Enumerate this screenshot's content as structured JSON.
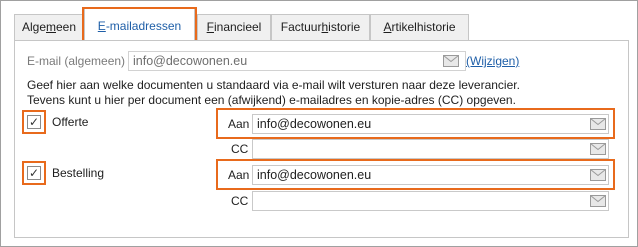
{
  "tabs": [
    {
      "label_pre": "Alge",
      "label_ul": "m",
      "label_post": "een",
      "active": false
    },
    {
      "label_pre": "",
      "label_ul": "E",
      "label_post": "-mailadressen",
      "active": true
    },
    {
      "label_pre": "",
      "label_ul": "F",
      "label_post": "inancieel",
      "active": false
    },
    {
      "label_pre": "Factuur",
      "label_ul": "h",
      "label_post": "istorie",
      "active": false
    },
    {
      "label_pre": "",
      "label_ul": "A",
      "label_post": "rtikelhistorie",
      "active": false
    }
  ],
  "general": {
    "label": "E-mail (algemeen)",
    "value": "info@decowonen.eu",
    "change_link": "(Wijzigen)"
  },
  "description": {
    "line1": "Geef hier aan welke documenten u standaard via e-mail wilt versturen naar deze leverancier.",
    "line2": "Tevens kunt u hier per document een (afwijkend) e-mailadres en kopie-adres (CC) opgeven."
  },
  "documents": [
    {
      "label": "Offerte",
      "checked": true,
      "to_label": "Aan",
      "to_value": "info@decowonen.eu",
      "cc_label": "CC",
      "cc_value": "",
      "check_glyph": "✓"
    },
    {
      "label": "Bestelling",
      "checked": true,
      "to_label": "Aan",
      "to_value": "info@decowonen.eu",
      "cc_label": "CC",
      "cc_value": "",
      "check_glyph": "✓"
    }
  ],
  "colors": {
    "highlight": "#e86a1c",
    "active_tab_text": "#1f5fa8",
    "link": "#1f5fa8"
  },
  "icons": {
    "mail": "envelope-icon",
    "check": "checkmark-icon"
  }
}
